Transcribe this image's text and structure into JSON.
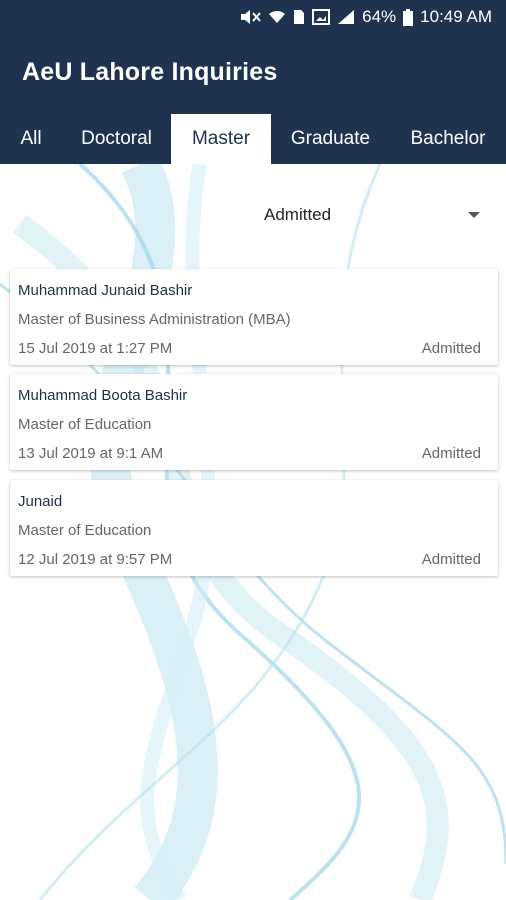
{
  "status_bar": {
    "battery": "64%",
    "time": "10:49 AM",
    "icons": [
      "mute-icon",
      "wifi-icon",
      "sim-icon",
      "screenshot-icon",
      "signal-icon",
      "battery-icon"
    ]
  },
  "app": {
    "title": "AeU Lahore Inquiries"
  },
  "tabs": [
    {
      "label": "All"
    },
    {
      "label": "Doctoral"
    },
    {
      "label": "Master"
    },
    {
      "label": "Graduate"
    },
    {
      "label": "Bachelor"
    }
  ],
  "active_tab": "Master",
  "filter": {
    "selected": "Admitted"
  },
  "inquiries": [
    {
      "name": "Muhammad Junaid Bashir",
      "program": "Master of Business Administration (MBA)",
      "date": "15 Jul 2019 at 1:27 PM",
      "status": "Admitted"
    },
    {
      "name": "Muhammad Boota Bashir",
      "program": "Master of Education",
      "date": "13 Jul 2019 at 9:1 AM",
      "status": "Admitted"
    },
    {
      "name": "Junaid",
      "program": "Master of Education",
      "date": "12 Jul 2019 at 9:57 PM",
      "status": "Admitted"
    }
  ],
  "colors": {
    "primary": "#1f3350",
    "active_tab_background": "#ffffff",
    "secondary_text": "#666666"
  }
}
